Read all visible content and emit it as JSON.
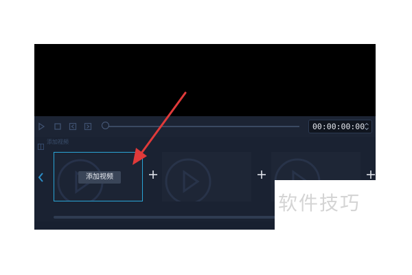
{
  "player": {
    "timecode": "00:00:00:00",
    "progress_fraction": 0.0
  },
  "timeline": {
    "label": "添加视频",
    "slots": [
      {
        "button_label": "添加视频",
        "selected": true
      },
      {
        "button_label": "",
        "selected": false
      },
      {
        "button_label": "",
        "selected": false
      }
    ]
  },
  "icons": {
    "play": "play-icon",
    "stop": "stop-icon",
    "prev": "prev-frame-icon",
    "next": "next-frame-icon",
    "add": "plus-icon",
    "nav_left": "chevron-left-icon"
  },
  "colors": {
    "panel": "#1a2232",
    "preview": "#000000",
    "selected_border": "#2aa6d8",
    "annotation_arrow": "#e03a3a"
  },
  "watermark": {
    "text": "软件技巧"
  }
}
